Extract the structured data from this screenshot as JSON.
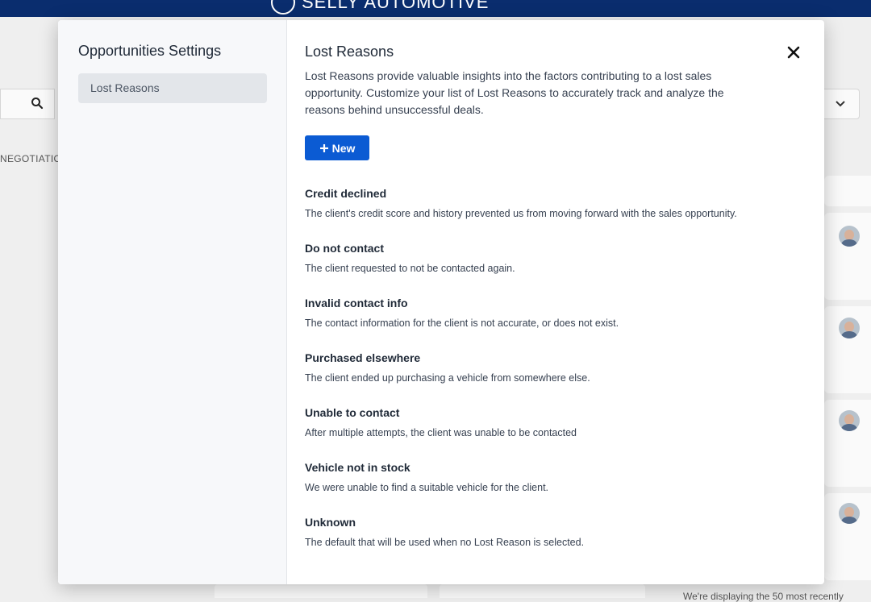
{
  "background": {
    "brand_name": "SELLY AUTOMOTIVE",
    "stage_label": "NEGOTIATION",
    "footnote": "We're displaying the 50 most recently"
  },
  "sidebar": {
    "title": "Opportunities Settings",
    "items": [
      {
        "label": "Lost Reasons",
        "selected": true
      }
    ]
  },
  "main": {
    "title": "Lost Reasons",
    "description": "Lost Reasons provide valuable insights into the factors contributing to a lost sales opportunity. Customize your list of Lost Reasons to accurately track and analyze the reasons behind unsuccessful deals.",
    "new_button_label": "New",
    "close_icon": "close-icon",
    "reasons": [
      {
        "title": "Credit declined",
        "description": "The client's credit score and history prevented us from moving forward with the sales opportunity."
      },
      {
        "title": "Do not contact",
        "description": "The client requested to not be contacted again."
      },
      {
        "title": "Invalid contact info",
        "description": "The contact information for the client is not accurate, or does not exist."
      },
      {
        "title": "Purchased elsewhere",
        "description": "The client ended up purchasing a vehicle from somewhere else."
      },
      {
        "title": "Unable to contact",
        "description": "After multiple attempts, the client was unable to be contacted"
      },
      {
        "title": "Vehicle not in stock",
        "description": "We were unable to find a suitable vehicle for the client."
      },
      {
        "title": "Unknown",
        "description": "The default that will be used when no Lost Reason is selected."
      }
    ]
  },
  "colors": {
    "brand_navy": "#0a2d6e",
    "primary_button": "#0b5bd3",
    "sidebar_bg": "#f7f8fa",
    "selected_item_bg": "#e3e6ea"
  }
}
